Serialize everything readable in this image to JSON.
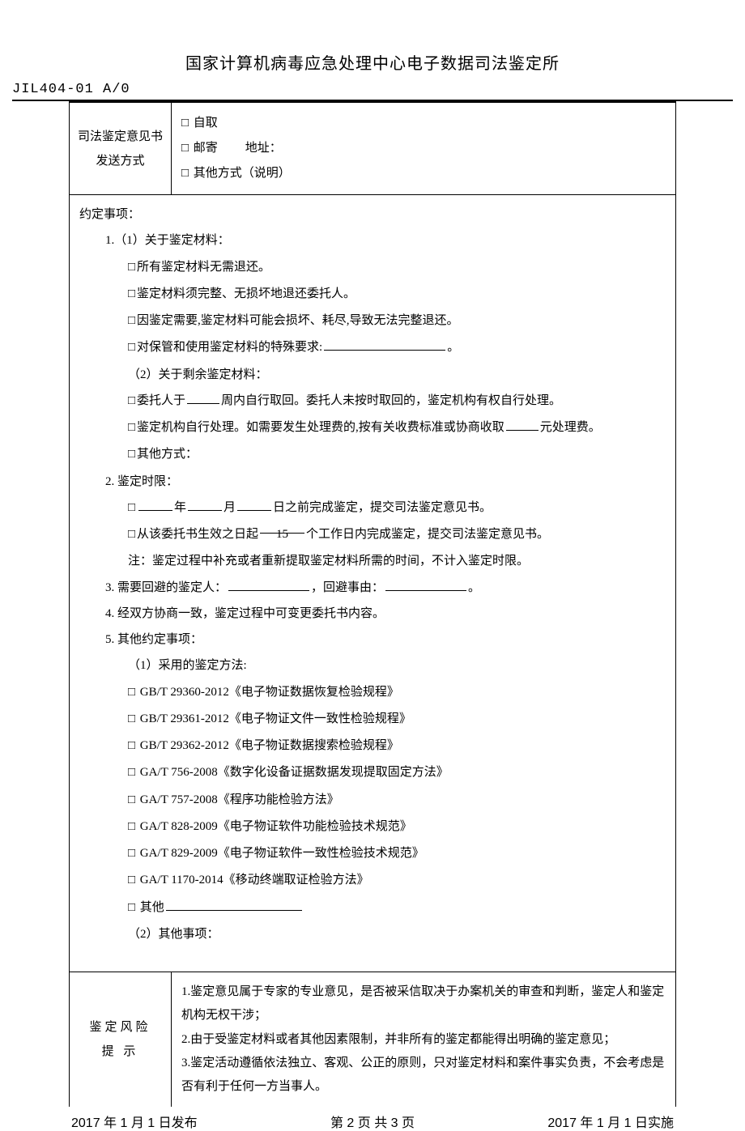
{
  "header": {
    "title": "国家计算机病毒应急处理中心电子数据司法鉴定所",
    "doc_code": "JIL404-01  A/0"
  },
  "delivery": {
    "label_line1": "司法鉴定意见书",
    "label_line2": "发送方式",
    "opt_self": "自取",
    "opt_mail": "邮寄",
    "addr_label": "地址：",
    "opt_other": "其他方式（说明）"
  },
  "agreed": {
    "heading": "约定事项：",
    "item1_title": "1.（1）关于鉴定材料：",
    "m1": "所有鉴定材料无需退还。",
    "m2": "鉴定材料须完整、无损坏地退还委托人。",
    "m3": "因鉴定需要,鉴定材料可能会损坏、耗尽,导致无法完整退还。",
    "m4_pre": "对保管和使用鉴定材料的特殊要求:",
    "m4_period": "。",
    "item1b_title": "（2）关于剩余鉴定材料：",
    "r1_pre": "委托人于",
    "r1_post": "周内自行取回。委托人未按时取回的，鉴定机构有权自行处理。",
    "r2_pre": "鉴定机构自行处理。如需要发生处理费的,按有关收费标准或协商收取",
    "r2_post": "元处理费。",
    "r3": "其他方式：",
    "item2_title": "2. 鉴定时限：",
    "d1_pre": "",
    "d1_y": "年",
    "d1_m": "月",
    "d1_d": "日之前完成鉴定，提交司法鉴定意见书。",
    "d2_pre": "从该委托书生效之日起",
    "d2_val": "15",
    "d2_post": "个工作日内完成鉴定，提交司法鉴定意见书。",
    "d_note": "注：鉴定过程中补充或者重新提取鉴定材料所需的时间，不计入鉴定时限。",
    "item3_pre": "3. 需要回避的鉴定人：",
    "item3_mid": "，回避事由：",
    "item3_end": "。",
    "item4": "4. 经双方协商一致，鉴定过程中可变更委托书内容。",
    "item5_title": "5. 其他约定事项：",
    "item5a": "（1）采用的鉴定方法:",
    "std1": "GB/T 29360-2012《电子物证数据恢复检验规程》",
    "std2": "GB/T 29361-2012《电子物证文件一致性检验规程》",
    "std3": "GB/T 29362-2012《电子物证数据搜索检验规程》",
    "std4": "GA/T 756-2008《数字化设备证据数据发现提取固定方法》",
    "std5": "GA/T 757-2008《程序功能检验方法》",
    "std6": "GA/T 828-2009《电子物证软件功能检验技术规范》",
    "std7": "GA/T 829-2009《电子物证软件一致性检验技术规范》",
    "std8": "GA/T 1170-2014《移动终端取证检验方法》",
    "std_other": "其他",
    "item5b": "（2）其他事项："
  },
  "risk": {
    "label1": "鉴定风险",
    "label2": "提 示",
    "r1": "1.鉴定意见属于专家的专业意见，是否被采信取决于办案机关的审查和判断，鉴定人和鉴定机构无权干涉；",
    "r2": "2.由于受鉴定材料或者其他因素限制，并非所有的鉴定都能得出明确的鉴定意见；",
    "r3": "3.鉴定活动遵循依法独立、客观、公正的原则，只对鉴定材料和案件事实负责，不会考虑是否有利于任何一方当事人。"
  },
  "footer": {
    "left": "2017 年 1 月 1 日发布",
    "center": "第 2 页 共 3 页",
    "right": "2017 年 1 月 1 日实施"
  }
}
